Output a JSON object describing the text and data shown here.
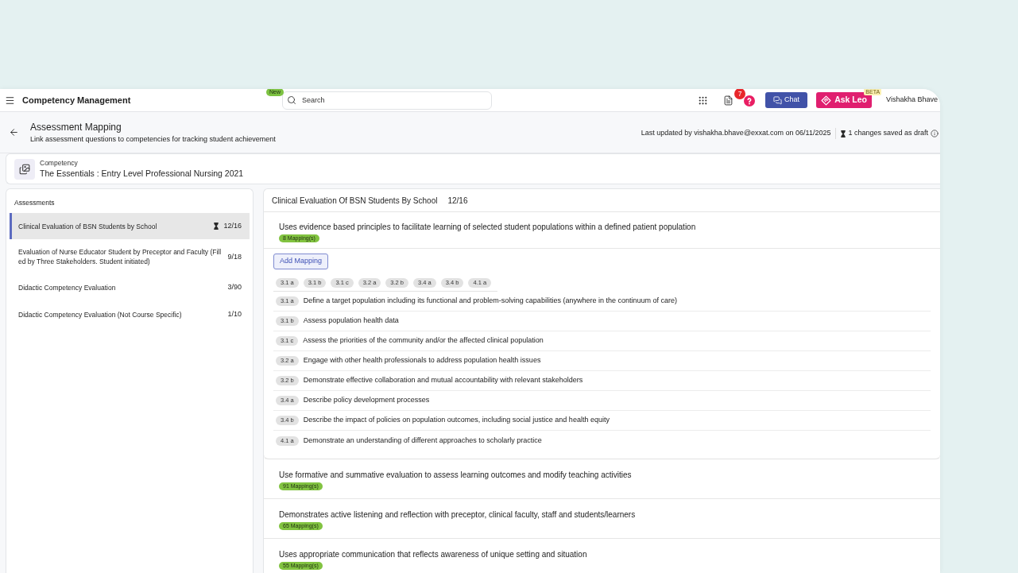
{
  "topbar": {
    "title": "Competency Management",
    "search": {
      "placeholder": "Search",
      "badge": "New"
    },
    "notification_count": "7",
    "chat_button": "Chat",
    "ask_button": {
      "label": "Ask Leo",
      "badge": "BETA"
    },
    "user_name": "Vishakha Bhave"
  },
  "header": {
    "title": "Assessment Mapping",
    "subtitle": "Link assessment questions to competencies for tracking student achievement",
    "last_updated": "Last updated by vishakha.bhave@exxat.com on 06/11/2025",
    "draft_status": "1 changes saved as draft"
  },
  "competency": {
    "label": "Competency",
    "name": "The Essentials : Entry Level Professional Nursing 2021"
  },
  "assessments": {
    "title": "Assessments",
    "items": [
      {
        "name": "Clinical Evaluation of BSN Students by School",
        "count": "12/16",
        "draft": true,
        "selected": true
      },
      {
        "name": "Evaluation of Nurse Educator Student by Preceptor and Faculty (Filled by Three Stakeholders. Student initiated)",
        "count": "9/18",
        "draft": false,
        "selected": false
      },
      {
        "name": "Didactic Competency Evaluation",
        "count": "3/90",
        "draft": false,
        "selected": false
      },
      {
        "name": "Didactic Competency Evaluation (Not Course Specific)",
        "count": "1/10",
        "draft": false,
        "selected": false
      }
    ]
  },
  "detail": {
    "title": "Clinical Evaluation Of BSN Students By School",
    "count": "12/16",
    "competencies": [
      {
        "text": "Uses evidence based principles to facilitate learning of selected student populations within a defined patient population",
        "mappings": "8 Mapping(s)",
        "expanded": true,
        "add_button": "Add Mapping",
        "codes": [
          "3.1 a",
          "3.1 b",
          "3.1 c",
          "3.2 a",
          "3.2 b",
          "3.4 a",
          "3.4 b",
          "4.1 a"
        ],
        "items": [
          {
            "code": "3.1 a",
            "text": "Define a target population including its functional and problem-solving capabilities (anywhere in the continuum of care)"
          },
          {
            "code": "3.1 b",
            "text": "Assess population health data"
          },
          {
            "code": "3.1 c",
            "text": "Assess the priorities of the community and/or the affected clinical population"
          },
          {
            "code": "3.2 a",
            "text": "Engage with other health professionals to address population health issues"
          },
          {
            "code": "3.2 b",
            "text": "Demonstrate effective collaboration and mutual accountability with relevant stakeholders"
          },
          {
            "code": "3.4 a",
            "text": "Describe policy development processes"
          },
          {
            "code": "3.4 b",
            "text": "Describe the impact of policies on population outcomes, including social justice and health equity"
          },
          {
            "code": "4.1 a",
            "text": "Demonstrate an understanding of different approaches to scholarly practice"
          }
        ]
      },
      {
        "text": "Use formative and summative evaluation to assess learning outcomes and modify teaching activities",
        "mappings": "91 Mapping(s)",
        "expanded": false
      },
      {
        "text": "Demonstrates active listening and reflection with preceptor, clinical faculty, staff and students/learners",
        "mappings": "65 Mapping(s)",
        "expanded": false
      },
      {
        "text": "Uses appropriate communication that reflects awareness of unique setting and situation",
        "mappings": "55 Mapping(s)",
        "expanded": false
      }
    ]
  }
}
